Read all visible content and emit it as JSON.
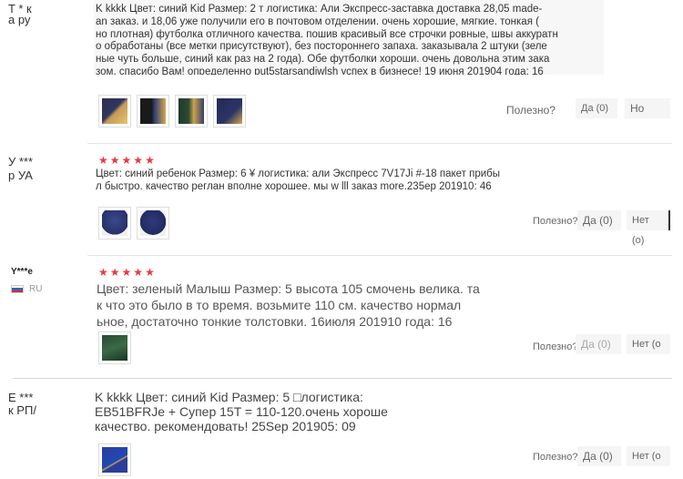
{
  "reviews": [
    {
      "user": "T * к\nа ру",
      "text": "K kkkk Цвет: синий Kid Размер: 2 т логистика: Али Экспресс-заставка доставка 28,05 made-\nan заказ. и 18,06 уже получили его в почтовом отделении. очень хорошие, мягкие. тонкая (\nно плотная) футболка отличного качества. пошив красивый все строчки ровные, швы аккуратн\nо обработаны (все метки присутствуют), без постороннего запаха. заказывала 2 штуки (зеле\nные чуть больше, синий как раз на 2 года). Обе футболки хороши. очень довольна этим зака\nзом. спасибо Вам! определенно put5starsandiwlsh успех в бизнесе! 19 июня 201904 года: 16",
      "helpful_label": "Полезно?",
      "yes_label": "Да (0)",
      "no_label": "Но"
    },
    {
      "user": "У ***\nр УА",
      "rating": 5,
      "text": "Цвет: синий ребенок Размер: 6 ¥ логистика: али Экспресс 7V17Ji #-18 пакет прибы\nл быстро. качество реглан вполне хорошее. мы w lll заказ more.235ep 201910: 46",
      "helpful_label": "Полезно?",
      "yes_label": "Да (0)",
      "no_label": "Нет (о)"
    },
    {
      "user": "Y***e",
      "country": "RU",
      "rating": 5,
      "text": "Цвет: зеленый Малыш Размер: 5 высота 105 смочень велика. та\nк что это было в то время. возьмите 110 см. качество нормал\nьное, достаточно тонкие толстовки. 16июля 201910 года: 16",
      "helpful_label": "Полезно?",
      "yes_label": "Да (0)",
      "no_label": "Нет (о"
    },
    {
      "user": "Е ***\nк РП/",
      "text": "K kkkk Цвет: синий Kid Размер: 5 □логистика:\nEB51BFRJe + Супер 15T = 110-120.очень хороше\nкачество. рекомендовать! 25Sep 201905: 09",
      "helpful_label": "Полезно?",
      "yes_label": "Да (0)",
      "no_label": "Нет (о"
    }
  ],
  "colors": {
    "star": "#e93b3d",
    "text": "#333333",
    "muted": "#999999"
  },
  "icons": {
    "star": "star-icon",
    "flag": "russia-flag-icon"
  }
}
